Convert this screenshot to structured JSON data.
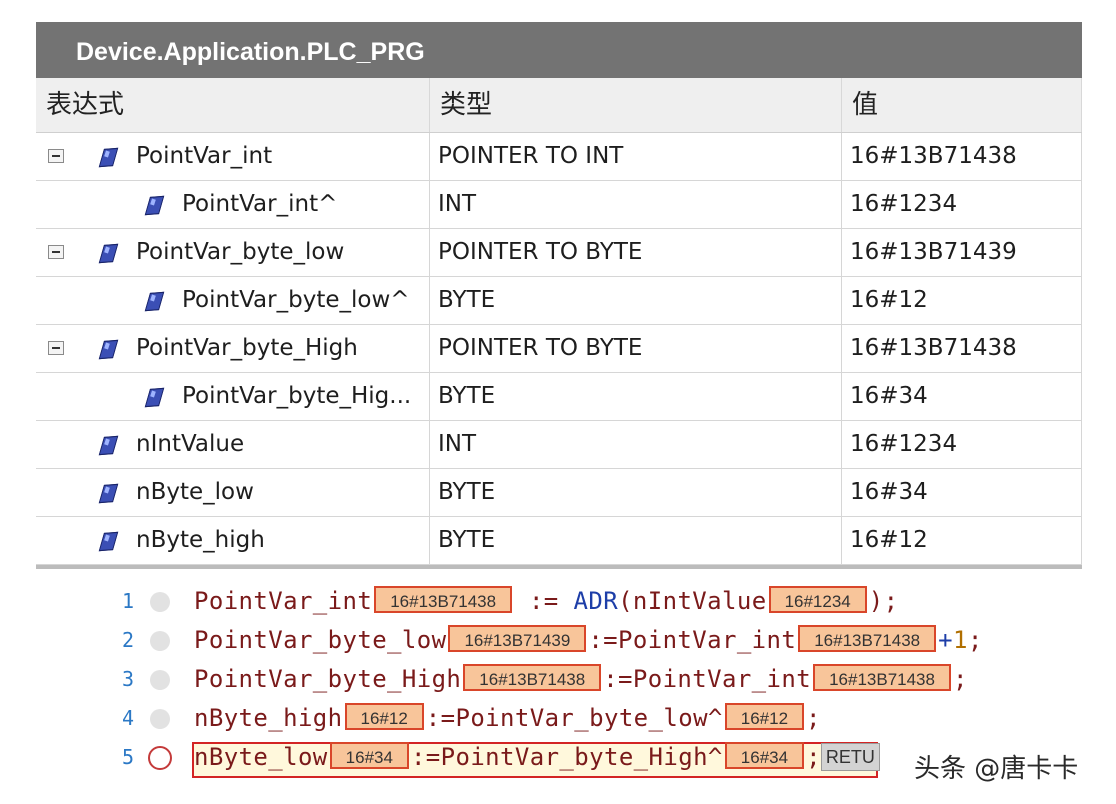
{
  "window": {
    "title": "Device.Application.PLC_PRG"
  },
  "columns": {
    "expression": "表达式",
    "type": "类型",
    "value": "值"
  },
  "rows": [
    {
      "name": "PointVar_int",
      "type": "POINTER TO INT",
      "value": "16#13B71438",
      "level": 0,
      "expandable": true
    },
    {
      "name": "PointVar_int^",
      "type": "INT",
      "value": "16#1234",
      "level": 1,
      "expandable": false
    },
    {
      "name": "PointVar_byte_low",
      "type": "POINTER TO BYTE",
      "value": "16#13B71439",
      "level": 0,
      "expandable": true
    },
    {
      "name": "PointVar_byte_low^",
      "type": "BYTE",
      "value": "16#12",
      "level": 1,
      "expandable": false
    },
    {
      "name": "PointVar_byte_High",
      "type": "POINTER TO BYTE",
      "value": "16#13B71438",
      "level": 0,
      "expandable": true
    },
    {
      "name": "PointVar_byte_Hig...",
      "type": "BYTE",
      "value": "16#34",
      "level": 1,
      "expandable": false
    },
    {
      "name": "nIntValue",
      "type": "INT",
      "value": "16#1234",
      "level": 0,
      "expandable": false
    },
    {
      "name": "nByte_low",
      "type": "BYTE",
      "value": "16#34",
      "level": 0,
      "expandable": false
    },
    {
      "name": "nByte_high",
      "type": "BYTE",
      "value": "16#12",
      "level": 0,
      "expandable": false
    }
  ],
  "code": [
    {
      "num": "1",
      "parts": [
        {
          "t": "txt",
          "v": "PointVar_int"
        },
        {
          "t": "mon",
          "v": "16#13B71438"
        },
        {
          "t": "txt",
          "v": " := "
        },
        {
          "t": "kw",
          "v": "ADR"
        },
        {
          "t": "txt",
          "v": "(nIntValue"
        },
        {
          "t": "mon",
          "v": "16#1234"
        },
        {
          "t": "txt",
          "v": ");"
        }
      ]
    },
    {
      "num": "2",
      "parts": [
        {
          "t": "txt",
          "v": "PointVar_byte_low"
        },
        {
          "t": "mon",
          "v": "16#13B71439"
        },
        {
          "t": "txt",
          "v": ":=PointVar_int"
        },
        {
          "t": "mon",
          "v": "16#13B71438"
        },
        {
          "t": "kw",
          "v": "+"
        },
        {
          "t": "num",
          "v": "1"
        },
        {
          "t": "txt",
          "v": ";"
        }
      ]
    },
    {
      "num": "3",
      "parts": [
        {
          "t": "txt",
          "v": "PointVar_byte_High"
        },
        {
          "t": "mon",
          "v": "16#13B71438"
        },
        {
          "t": "txt",
          "v": ":=PointVar_int"
        },
        {
          "t": "mon",
          "v": "16#13B71438"
        },
        {
          "t": "txt",
          "v": ";"
        }
      ]
    },
    {
      "num": "4",
      "parts": [
        {
          "t": "txt",
          "v": "nByte_high"
        },
        {
          "t": "mon",
          "v": "16#12"
        },
        {
          "t": "txt",
          "v": ":=PointVar_byte_low^"
        },
        {
          "t": "mon",
          "v": "16#12"
        },
        {
          "t": "txt",
          "v": ";"
        }
      ]
    },
    {
      "num": "5",
      "current": true,
      "parts": [
        {
          "t": "txt",
          "v": "nByte_low"
        },
        {
          "t": "mon",
          "v": "16#34"
        },
        {
          "t": "txt",
          "v": ":=PointVar_byte_High^"
        },
        {
          "t": "mon",
          "v": "16#34"
        },
        {
          "t": "txt",
          "v": ";"
        },
        {
          "t": "retu",
          "v": "RETU"
        }
      ]
    }
  ],
  "watermark": "头条 @唐卡卡"
}
